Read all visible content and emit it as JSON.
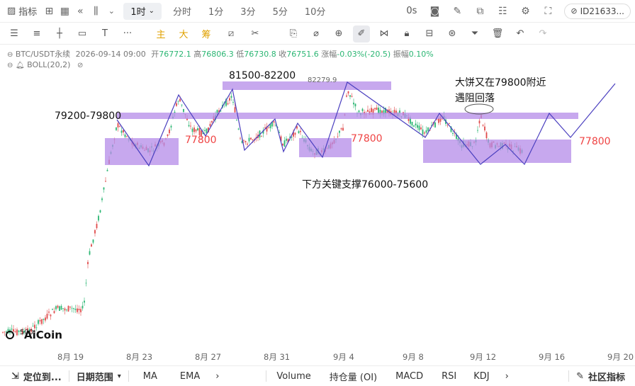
{
  "topbar": {
    "indicator_label": "指标",
    "timeframes": [
      "1时",
      "分时",
      "1分",
      "3分",
      "5分",
      "10分"
    ],
    "active_timeframe": "1时",
    "countdown": "0s",
    "account": "ID21633..."
  },
  "drawbar": {
    "cn_tools": [
      "主",
      "大",
      "筹"
    ]
  },
  "legend": {
    "symbol": "BTC/USDT永续",
    "datetime": "2026-09-14 09:00",
    "open_label": "开",
    "open": "76772.1",
    "high_label": "高",
    "high": "76806.3",
    "low_label": "低",
    "low": "76730.8",
    "close_label": "收",
    "close": "76751.6",
    "change_label": "涨幅",
    "change": "-0.03%(-20.5)",
    "amp_label": "振幅",
    "amp": "0.10%",
    "boll": "BOLL(20,2)"
  },
  "annotations": {
    "range_left": "79200-79800",
    "range_top": "81500-82200",
    "peak_value": "82279.9",
    "level_a": "77800",
    "level_b": "77800",
    "level_c": "77800",
    "support": "下方关键支撑76000-75600",
    "comment_line1": "大饼又在79800附近",
    "comment_line2": "遇阻回落",
    "low_value": "500",
    "watermark": "AiCoin"
  },
  "xaxis": [
    "8月 19",
    "8月 23",
    "8月 27",
    "8月 31",
    "9月 4",
    "9月 8",
    "9月 12",
    "9月 16",
    "9月 20"
  ],
  "bottombar": {
    "locate": "定位到...",
    "date_range": "日期范围",
    "indicators": [
      "MA",
      "EMA"
    ],
    "sub_indicators": [
      "Volume",
      "持仓量 (OI)",
      "MACD",
      "RSI",
      "KDJ"
    ],
    "community": "社区指标"
  },
  "colors": {
    "up": "#2bb673",
    "down": "#e04b4b",
    "zone": "#b48be8",
    "line": "#4a3fbf",
    "label_red": "#ef4444"
  }
}
